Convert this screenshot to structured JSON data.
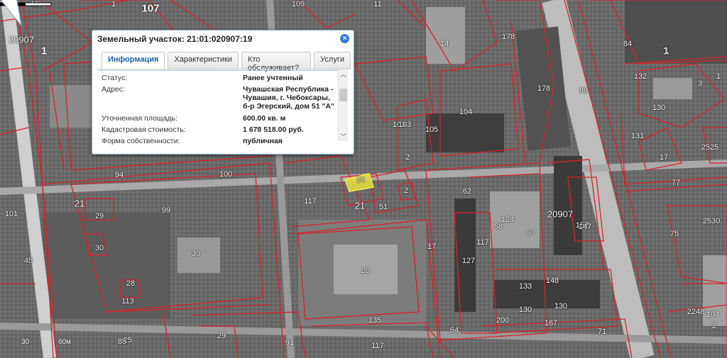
{
  "popup": {
    "title": "Земельный участок: 21:01:020907:19",
    "close_icon": "close-icon",
    "tabs": [
      {
        "label": "Информация",
        "active": true
      },
      {
        "label": "Характеристики",
        "active": false
      },
      {
        "label": "Кто обслуживает?",
        "active": false
      },
      {
        "label": "Услуги",
        "active": false
      }
    ],
    "rows": [
      {
        "key": "Статус:",
        "value": "Ранее учтенный"
      },
      {
        "key": "Адрес:",
        "value": "Чувашская Республика - Чувашия, г. Чебоксары, б-р Эгерский, дом 51 \"А\""
      },
      {
        "key": "Уточненная площадь:",
        "value": "600.00 кв. м"
      },
      {
        "key": "Кадастровая стоимость:",
        "value": "1 678 518.00 руб."
      },
      {
        "key": "Форма собственности:",
        "value": "публичная"
      }
    ]
  },
  "scale": {
    "label_30": "30",
    "label_60": "60м"
  },
  "parcel_labels": [
    "48",
    "107",
    "20907",
    "1",
    "1",
    "40",
    "109",
    "11",
    "14",
    "178",
    "98",
    "84",
    "1",
    "132",
    "1",
    "130",
    "3",
    "131",
    "17",
    "77",
    "2530",
    "2525",
    "75",
    "104",
    "1",
    "25",
    "103",
    "105",
    "104",
    "178",
    "100",
    "99",
    "94",
    "20",
    "62",
    "124",
    "21",
    "17",
    "30",
    "51",
    "117",
    "58",
    "57",
    "20907",
    "157",
    "28",
    "21",
    "29",
    "91",
    "85",
    "147",
    "113",
    "30",
    "45",
    "29",
    "127",
    "117",
    "64",
    "133",
    "148",
    "130",
    "130",
    "71",
    "167",
    "135",
    "200",
    "2248",
    "2",
    "117",
    "101",
    "1",
    "103",
    "2",
    "2",
    "20"
  ],
  "colors": {
    "parcel_line": "#d8232a",
    "road": "#ffffff",
    "highlight": "#e8e23a",
    "popup_tab_active": "#1c62a6",
    "close_button": "#2f7ed8"
  }
}
